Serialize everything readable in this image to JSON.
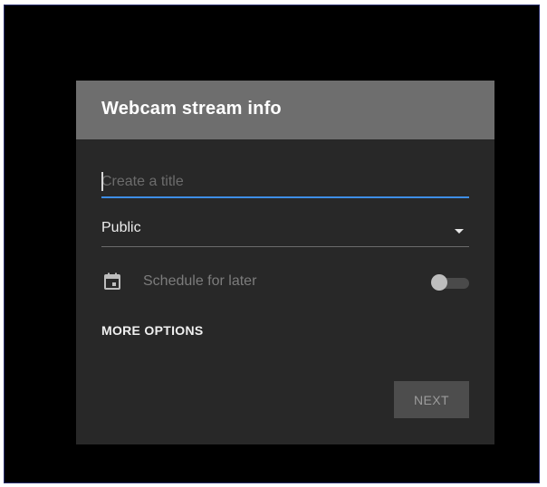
{
  "dialog": {
    "title": "Webcam stream info",
    "title_field": {
      "value": "",
      "placeholder": "Create a title"
    },
    "visibility": {
      "selected": "Public",
      "icon": "dropdown-arrow-icon"
    },
    "schedule": {
      "label": "Schedule for later",
      "icon": "calendar-icon",
      "enabled": false
    },
    "more_options_label": "MORE OPTIONS",
    "next_label": "NEXT"
  },
  "colors": {
    "backdrop": "#000000",
    "header": "#6e6e6e",
    "dialog": "#282828",
    "accent": "#3e8ee6",
    "button": "#4d4d4d"
  }
}
